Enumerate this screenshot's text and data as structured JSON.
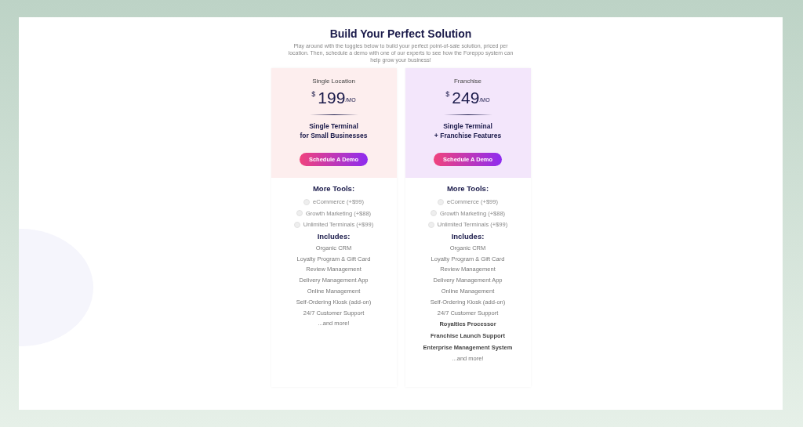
{
  "title": "Build Your Perfect Solution",
  "subtitle": "Play around with the toggles below to build your perfect point-of-sale solution, priced per location. Then, schedule a demo with one of our experts to see how the Foreppo system can help grow your business!",
  "plans": [
    {
      "name": "Single Location",
      "currency": "$",
      "price": "199",
      "period": "/MO",
      "color": "#fdeeee",
      "tagline": [
        "Single Terminal",
        "for Small Businesses"
      ],
      "button": "Schedule A Demo",
      "tools_heading": "More Tools:",
      "tools": [
        {
          "label": "eCommerce (+$99)",
          "checked": false
        },
        {
          "label": "Growth Marketing (+$88)",
          "checked": false
        },
        {
          "label": "Unlimited Terminals (+$99)",
          "checked": false
        }
      ],
      "includes_heading": "Includes:",
      "includes": [
        {
          "text": "Organic CRM",
          "bold": false
        },
        {
          "text": "Loyalty Program & Gift Card",
          "bold": false
        },
        {
          "text": "Review Management",
          "bold": false
        },
        {
          "text": "Delivery Management App",
          "bold": false
        },
        {
          "text": "Online Management",
          "bold": false
        },
        {
          "text": "Self-Ordering Kiosk (add-on)",
          "bold": false
        },
        {
          "text": "24/7 Customer Support",
          "bold": false
        },
        {
          "text": "...and more!",
          "bold": false
        }
      ]
    },
    {
      "name": "Franchise",
      "currency": "$",
      "price": "249",
      "period": "/MO",
      "color": "#f3e6fb",
      "tagline": [
        "Single Terminal",
        "+ Franchise Features"
      ],
      "button": "Schedule A Demo",
      "tools_heading": "More Tools:",
      "tools": [
        {
          "label": "eCommerce (+$99)",
          "checked": false
        },
        {
          "label": "Growth Marketing (+$88)",
          "checked": false
        },
        {
          "label": "Unlimited Terminals (+$99)",
          "checked": false
        }
      ],
      "includes_heading": "Includes:",
      "includes": [
        {
          "text": "Organic CRM",
          "bold": false
        },
        {
          "text": "Loyalty Program & Gift Card",
          "bold": false
        },
        {
          "text": "Review Management",
          "bold": false
        },
        {
          "text": "Delivery Management App",
          "bold": false
        },
        {
          "text": "Online Management",
          "bold": false
        },
        {
          "text": "Self-Ordering Kiosk (add-on)",
          "bold": false
        },
        {
          "text": "24/7 Customer Support",
          "bold": false
        },
        {
          "text": "Royalties Processor",
          "bold": true
        },
        {
          "text": "Franchise Launch Support",
          "bold": true
        },
        {
          "text": "Enterprise Management System",
          "bold": true
        },
        {
          "text": "...and more!",
          "bold": false
        }
      ]
    }
  ]
}
